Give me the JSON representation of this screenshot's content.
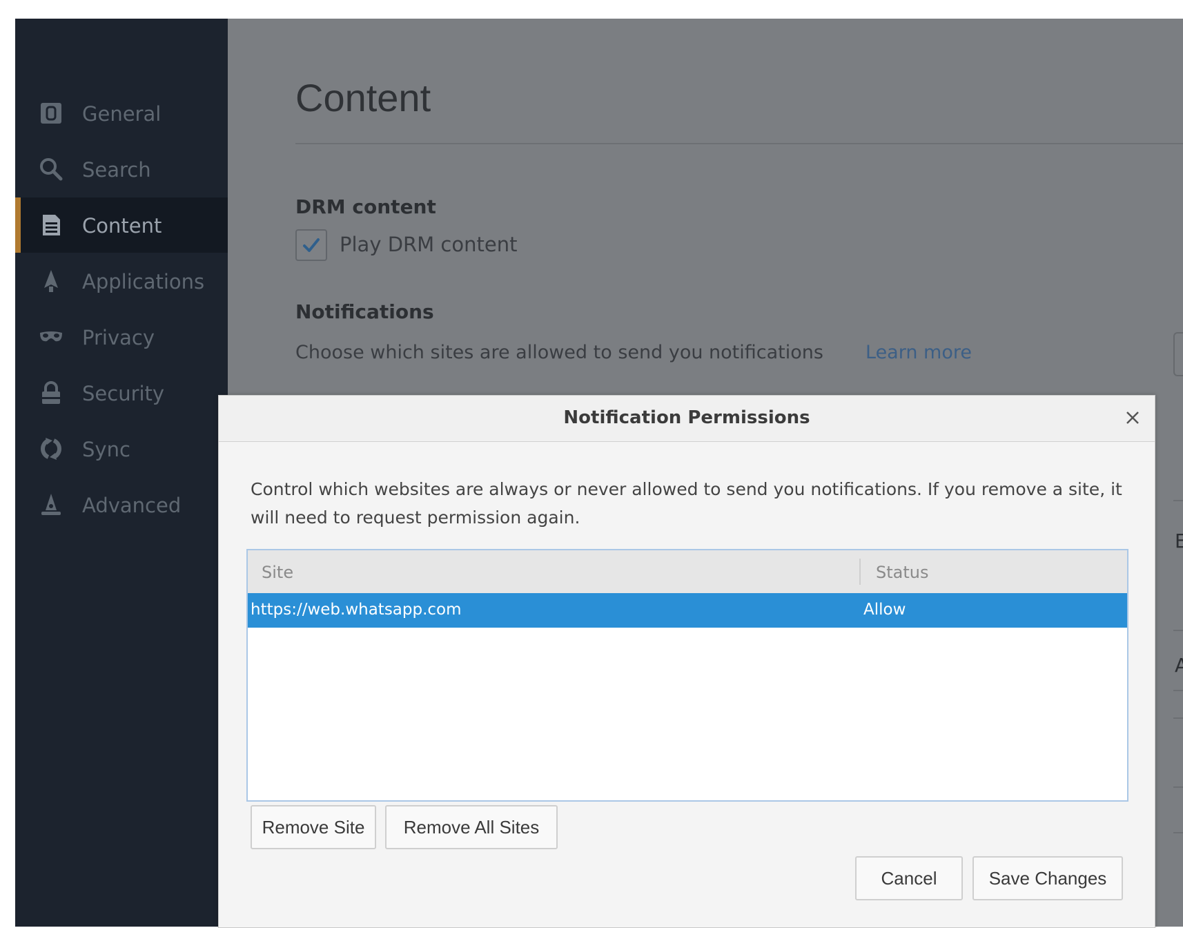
{
  "sidebar": {
    "items": [
      {
        "label": "General",
        "icon": "general-icon"
      },
      {
        "label": "Search",
        "icon": "search-icon"
      },
      {
        "label": "Content",
        "icon": "content-icon",
        "active": true
      },
      {
        "label": "Applications",
        "icon": "applications-icon"
      },
      {
        "label": "Privacy",
        "icon": "privacy-icon"
      },
      {
        "label": "Security",
        "icon": "security-icon"
      },
      {
        "label": "Sync",
        "icon": "sync-icon"
      },
      {
        "label": "Advanced",
        "icon": "advanced-icon"
      }
    ]
  },
  "main": {
    "title": "Content",
    "drm": {
      "heading": "DRM content",
      "checkbox_label": "Play DRM content",
      "checked": true
    },
    "notifications": {
      "heading": "Notifications",
      "description": "Choose which sites are allowed to send you notifications",
      "learn_more": "Learn more"
    },
    "right_partial": {
      "text_1": "Ex",
      "text_2": "A"
    }
  },
  "dialog": {
    "title": "Notification Permissions",
    "description": "Control which websites are always or never allowed to send you notifications. If you remove a site, it will need to request permission again.",
    "table": {
      "columns": [
        "Site",
        "Status"
      ],
      "rows": [
        {
          "site": "https://web.whatsapp.com",
          "status": "Allow",
          "selected": true
        }
      ]
    },
    "buttons": {
      "remove_site": "Remove Site",
      "remove_all": "Remove All Sites",
      "cancel": "Cancel",
      "save": "Save Changes"
    }
  },
  "colors": {
    "sidebar_bg": "#1c232e",
    "accent": "#b07a30",
    "selection": "#2a8fd6",
    "link": "#3c5f86"
  }
}
